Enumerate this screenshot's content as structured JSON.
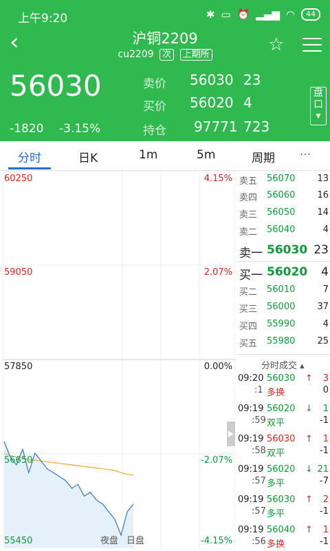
{
  "status": {
    "time": "上午9:20",
    "battery": "44"
  },
  "header": {
    "title": "沪铜2209",
    "code": "cu2209",
    "tag1": "次",
    "tag2": "上期所"
  },
  "price": {
    "last": "56030",
    "change": "-1820",
    "pct": "-3.15%"
  },
  "quote": {
    "sell_label": "卖价",
    "sell_price": "56030",
    "sell_vol": "23",
    "buy_label": "买价",
    "buy_price": "56020",
    "buy_vol": "4",
    "oi_label": "持仓",
    "oi": "97771",
    "oi_chg": "723",
    "pankou": "盘口"
  },
  "tabs": [
    "分时",
    "日K",
    "1m",
    "5m",
    "周期",
    "···"
  ],
  "chart": {
    "y_labels": [
      "60250",
      "59050",
      "57850",
      "56650",
      "55450"
    ],
    "pct_labels": [
      "4.15%",
      "2.07%",
      "0.00%",
      "-2.07%",
      "-4.15%"
    ],
    "session_night": "夜盘",
    "session_day": "日盘"
  },
  "chart_data": {
    "type": "line",
    "ylim": [
      55450,
      60250
    ],
    "price_series": [
      56800,
      56600,
      56500,
      56700,
      56400,
      56650,
      56550,
      56450,
      56400,
      56350,
      56300,
      56200,
      56250,
      56100,
      56150,
      56050,
      56000,
      55900,
      55800,
      55600,
      55900,
      56000
    ],
    "avg_series": [
      56650,
      56620,
      56600,
      56590,
      56570,
      56560,
      56550,
      56540,
      56530,
      56520,
      56510,
      56500,
      56490,
      56480,
      56470,
      56460,
      56450,
      56440,
      56430,
      56400,
      56380,
      56370
    ]
  },
  "orderbook": {
    "asks": [
      {
        "label": "卖五",
        "price": "56070",
        "vol": "13"
      },
      {
        "label": "卖四",
        "price": "56060",
        "vol": "16"
      },
      {
        "label": "卖三",
        "price": "56050",
        "vol": "14"
      },
      {
        "label": "卖二",
        "price": "56040",
        "vol": "4"
      },
      {
        "label": "卖一",
        "price": "56030",
        "vol": "23"
      }
    ],
    "bids": [
      {
        "label": "买一",
        "price": "56020",
        "vol": "4"
      },
      {
        "label": "买二",
        "price": "56010",
        "vol": "7"
      },
      {
        "label": "买三",
        "price": "56000",
        "vol": "37"
      },
      {
        "label": "买四",
        "price": "55990",
        "vol": "4"
      },
      {
        "label": "买五",
        "price": "55980",
        "vol": "25"
      }
    ]
  },
  "trades": {
    "header": "分时成交",
    "rows": [
      {
        "t1": "09:20",
        "t2": ":1",
        "price": "56030",
        "arrow": "↑",
        "v": "3",
        "type": "多换",
        "d": "0"
      },
      {
        "t1": "09:19",
        "t2": ":59",
        "price": "56020",
        "arrow": "↓",
        "v": "1",
        "type": "双平",
        "d": "-1"
      },
      {
        "t1": "09:19",
        "t2": ":58",
        "price": "56030",
        "arrow": "↑",
        "v": "1",
        "type": "双平",
        "d": "-1"
      },
      {
        "t1": "09:19",
        "t2": ":57",
        "price": "56020",
        "arrow": "↓",
        "v": "21",
        "type": "多平",
        "d": "-7"
      },
      {
        "t1": "09:19",
        "t2": ":57",
        "price": "56030",
        "arrow": "↑",
        "v": "2",
        "type": "多平",
        "d": "-1"
      },
      {
        "t1": "09:19",
        "t2": ":56",
        "price": "56040",
        "arrow": "↑",
        "v": "1",
        "type": "多换",
        "d": "-1"
      }
    ]
  },
  "colors": {
    "green": "#2fb94f",
    "red": "#d9251d",
    "blue": "#1f6fd6"
  }
}
